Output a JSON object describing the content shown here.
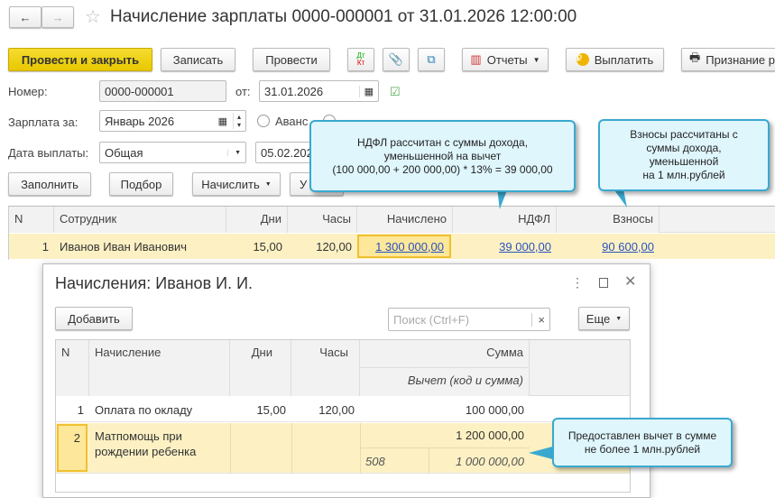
{
  "window": {
    "title": "Начисление зарплаты 0000-000001 от 31.01.2026 12:00:00"
  },
  "toolbar": {
    "post_close": "Провести и закрыть",
    "save": "Записать",
    "post": "Провести",
    "dtkt_top": "Дт",
    "dtkt_bottom": "Кт",
    "reports": "Отчеты",
    "pay": "Выплатить",
    "recognition": "Признание р"
  },
  "form": {
    "number_label": "Номер:",
    "number": "0000-000001",
    "date_label": "от:",
    "date": "31.01.2026",
    "period_label": "Зарплата за:",
    "period": "Январь 2026",
    "radio_advance": "Аванс",
    "paydate_label": "Дата выплаты:",
    "paydate_type": "Общая",
    "paydate": "05.02.2026"
  },
  "actions": {
    "fill": "Заполнить",
    "select": "Подбор",
    "accrue": "Начислить",
    "other": "У"
  },
  "main_table": {
    "headers": [
      "N",
      "Сотрудник",
      "Дни",
      "Часы",
      "Начислено",
      "НДФЛ",
      "Взносы"
    ],
    "rows": [
      {
        "n": "1",
        "employee": "Иванов Иван Иванович",
        "days": "15,00",
        "hours": "120,00",
        "accrued": "1 300 000,00",
        "ndfl": "39 000,00",
        "contrib": "90 600,00"
      }
    ]
  },
  "dialog": {
    "title": "Начисления: Иванов И. И.",
    "add": "Добавить",
    "search_placeholder": "Поиск (Ctrl+F)",
    "clear": "×",
    "more": "Еще",
    "headers": {
      "n": "N",
      "accrual": "Начисление",
      "days": "Дни",
      "hours": "Часы",
      "sum": "Сумма",
      "deduction": "Вычет (код и сумма)"
    },
    "rows": [
      {
        "n": "1",
        "accrual": "Оплата по окладу",
        "days": "15,00",
        "hours": "120,00",
        "sum": "100 000,00",
        "ded_code": "",
        "ded_sum": ""
      },
      {
        "n": "2",
        "accrual": "Матпомощь при рождении ребенка",
        "days": "",
        "hours": "",
        "sum": "1 200 000,00",
        "ded_code": "508",
        "ded_sum": "1 000 000,00"
      }
    ]
  },
  "callouts": {
    "ndfl": [
      "НДФЛ рассчитан с суммы дохода,",
      "уменьшенной на вычет",
      "(100 000,00 + 200 000,00) * 13% = 39 000,00"
    ],
    "contrib": [
      "Взносы рассчитаны с",
      "суммы дохода,",
      "уменьшенной",
      "на 1 млн.рублей"
    ],
    "deduction": [
      "Предоставлен вычет в сумме",
      "не более 1 млн.рублей"
    ]
  },
  "colors": {
    "accent_yellow": "#f0d000",
    "row_highlight": "#fdf1c4",
    "callout_bg": "#dff6fd",
    "callout_border": "#3aa9cf",
    "link": "#2a52be"
  }
}
